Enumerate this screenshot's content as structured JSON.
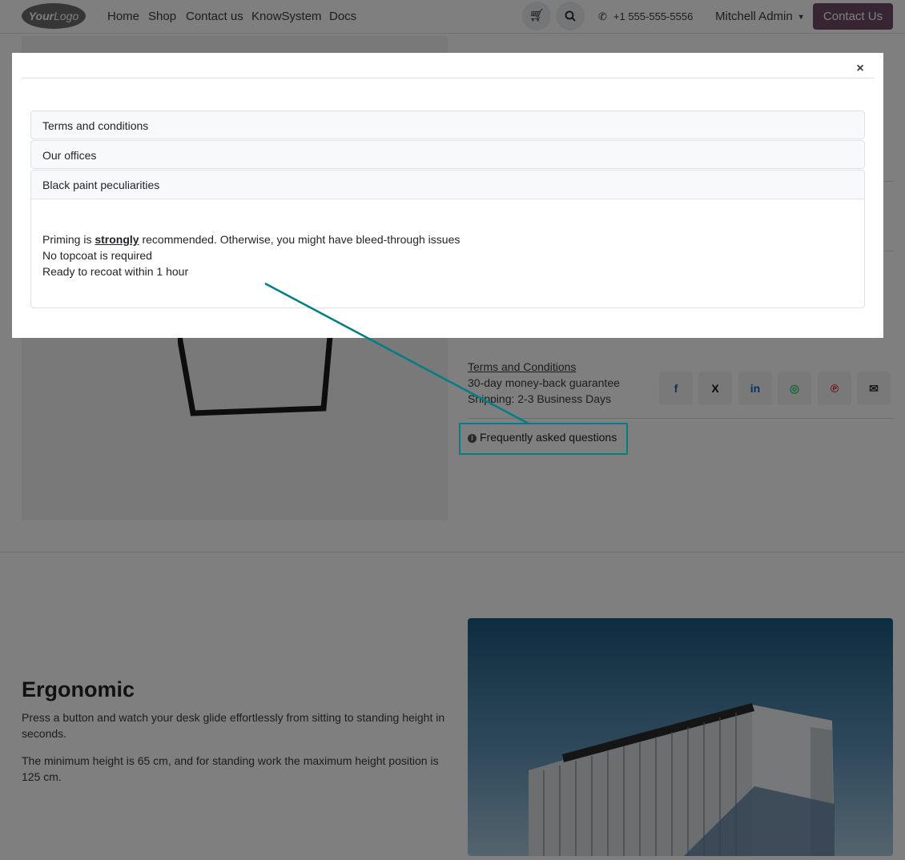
{
  "nav": {
    "logo": {
      "bold": "Your",
      "rest": "Logo"
    },
    "links": [
      "Home",
      "Shop",
      "Contact us",
      "KnowSystem",
      "Docs"
    ],
    "phone": "+1 555-555-5556",
    "user": "Mitchell Admin",
    "cta": "Contact Us"
  },
  "product": {
    "terms_link": "Terms and Conditions",
    "guarantee": "30-day money-back guarantee",
    "shipping": "Shipping: 2-3 Business Days",
    "share": {
      "facebook": "f",
      "x": "X",
      "linkedin": "in",
      "whatsapp": "◎",
      "pinterest": "℗",
      "email": "✉"
    },
    "faq": "Frequently asked questions"
  },
  "section": {
    "title": "Ergonomic",
    "p1": "Press a button and watch your desk glide effortlessly from sitting to standing height in seconds.",
    "p2": "The minimum height is 65 cm, and for standing work the maximum height position is 125 cm."
  },
  "modal": {
    "close": "×",
    "items": [
      {
        "title": "Terms and conditions"
      },
      {
        "title": "Our offices"
      },
      {
        "title": "Black paint peculiarities"
      }
    ],
    "body": {
      "l1_pre": "Priming is ",
      "l1_strong": "strongly",
      "l1_post": " recommended. Otherwise, you might have bleed-through issues",
      "l2": "No topcoat is required",
      "l3": "Ready to recoat within 1 hour"
    }
  },
  "colors": {
    "accent": "#714b67",
    "highlight": "#017e84"
  }
}
